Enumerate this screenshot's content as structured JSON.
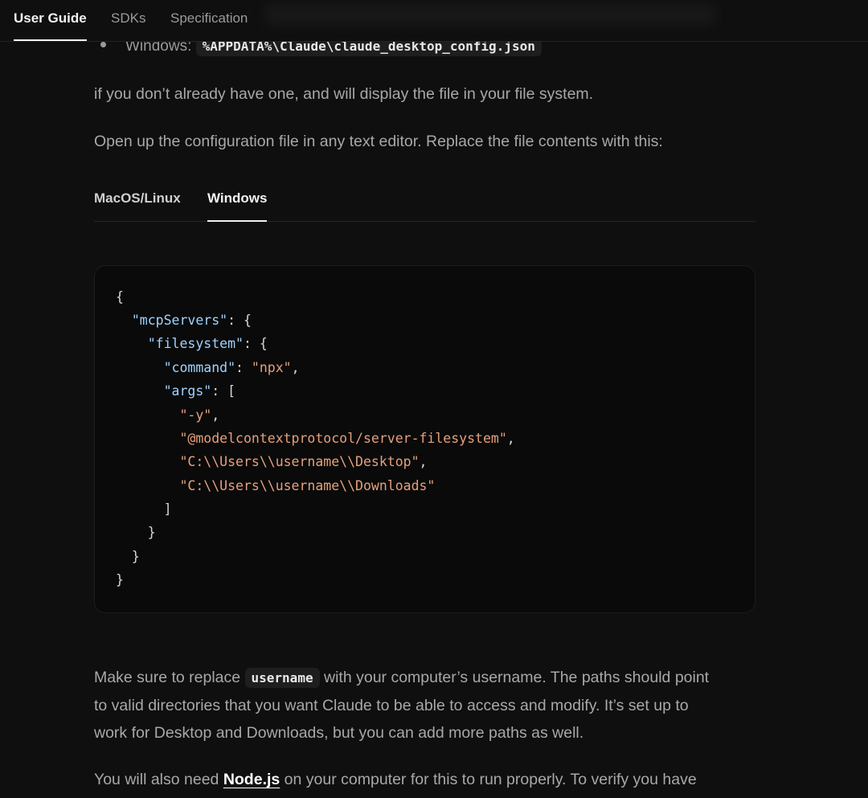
{
  "nav": {
    "tabs": [
      "User Guide",
      "SDKs",
      "Specification"
    ],
    "active_index": 0
  },
  "bullet": {
    "label": "Windows:",
    "path": "%APPDATA%\\Claude\\claude_desktop_config.json"
  },
  "para1": "if you don’t already have one, and will display the file in your file system.",
  "para2": "Open up the configuration file in any text editor. Replace the file contents with this:",
  "code_tabs": {
    "macos": "MacOS/Linux",
    "windows": "Windows",
    "active": "Windows"
  },
  "code": {
    "open_brace": "{",
    "k_mcpServers": "\"mcpServers\"",
    "k_filesystem": "\"filesystem\"",
    "k_command": "\"command\"",
    "v_command": "\"npx\"",
    "k_args": "\"args\"",
    "a1": "\"-y\"",
    "a2": "\"@modelcontextprotocol/server-filesystem\"",
    "a3": "\"C:\\\\Users\\\\username\\\\Desktop\"",
    "a4": "\"C:\\\\Users\\\\username\\\\Downloads\"",
    "close_bracket": "]",
    "close_brace": "}"
  },
  "para3": {
    "before": "Make sure to replace",
    "code": "username",
    "after_line1": "with your computer’s username. The paths should point",
    "line2": "to valid directories that you want Claude to be able to access and modify. It’s set up to",
    "line3": "work for Desktop and Downloads, but you can add more paths as well."
  },
  "para4": {
    "before": "You will also need",
    "link": "Node.js",
    "after": "on your computer for this to run properly. To verify you have"
  }
}
